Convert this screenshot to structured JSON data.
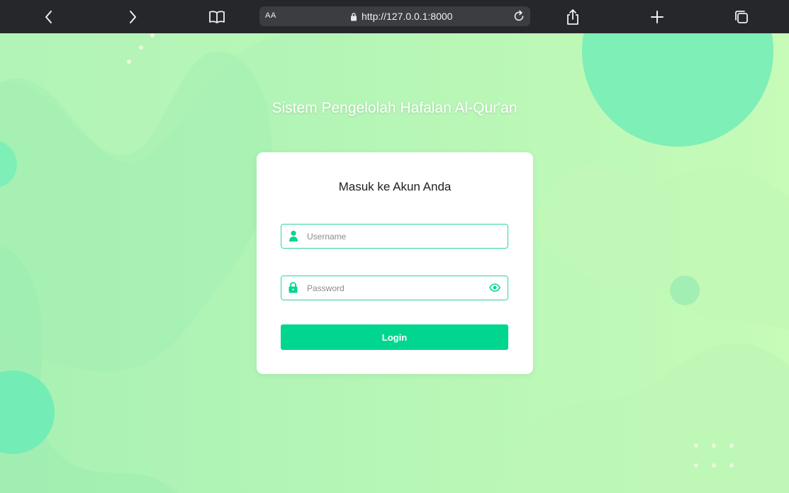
{
  "browser": {
    "address_prefix": "AA",
    "url": "http://127.0.0.1:8000",
    "icons": [
      "back-icon",
      "forward-icon",
      "book-icon",
      "lock-icon",
      "reload-icon",
      "share-icon",
      "plus-icon",
      "tabs-icon"
    ]
  },
  "page": {
    "app_title": "Sistem Pengelolah Hafalan Al-Qur'an",
    "card_title": "Masuk ke Akun Anda",
    "username_placeholder": "Username",
    "password_placeholder": "Password",
    "login_label": "Login"
  },
  "colors": {
    "accent": "#00d68f",
    "field_border": "#2fd698",
    "background_green": "#b4f5b8",
    "blob_green": "#7eefb6",
    "toolbar": "#25272a"
  }
}
